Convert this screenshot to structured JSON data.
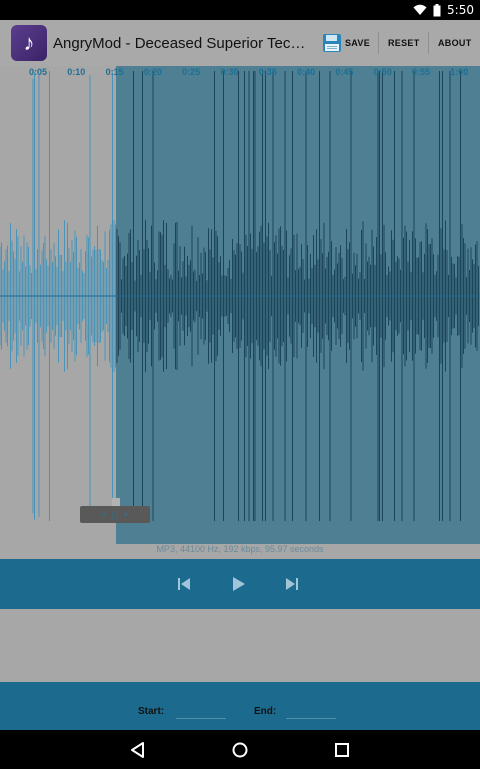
{
  "status_bar": {
    "time": "5:50",
    "icons": [
      "wifi-icon",
      "battery-icon"
    ]
  },
  "app_bar": {
    "title": "AngryMod - Deceased Superior Techni...",
    "save_label": "SAVE",
    "reset_label": "RESET",
    "about_label": "ABOUT",
    "icon": "music-note-icon"
  },
  "timeline": {
    "ticks": [
      "0:05",
      "0:10",
      "0:15",
      "0:20",
      "0:25",
      "0:30",
      "0:35",
      "0:40",
      "0:45",
      "0:50",
      "0:55",
      "1:00"
    ]
  },
  "file_info": "MP3, 44100 Hz, 192 kbps, 95.97 seconds",
  "controls": {
    "icons": [
      "skip-previous-icon",
      "play-icon",
      "skip-next-icon"
    ]
  },
  "fields": {
    "start_label": "Start:",
    "start_value": "",
    "end_label": "End:",
    "end_value": ""
  },
  "colors": {
    "accent": "#1c6b8f",
    "selection": "#4f7f93",
    "background": "#a7a7a7",
    "tick_text": "#1d6f93"
  },
  "nav_bar": {
    "icons": [
      "back-icon",
      "home-icon",
      "recents-icon"
    ]
  }
}
